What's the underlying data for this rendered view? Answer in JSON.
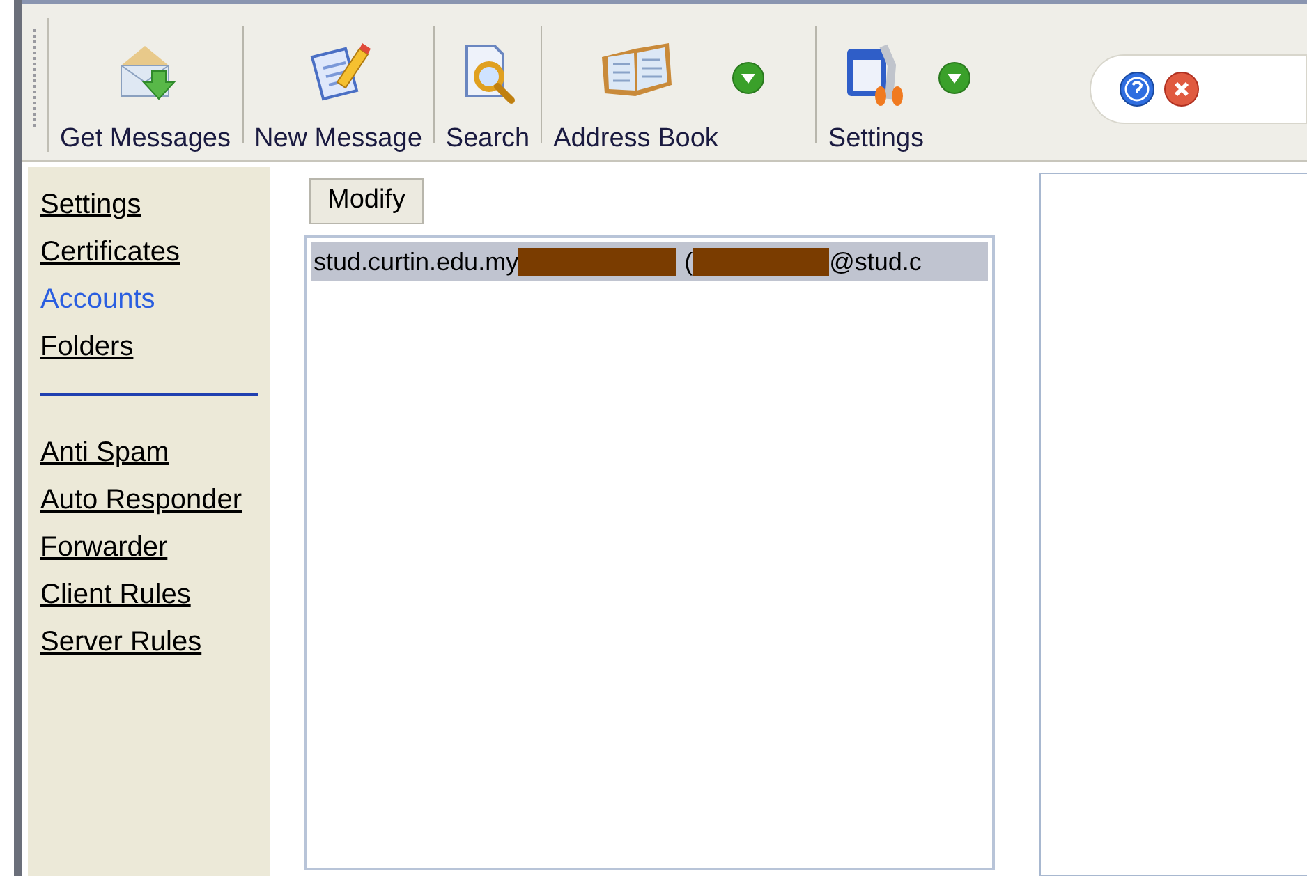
{
  "toolbar": {
    "buttons": [
      {
        "label": "Get Messages",
        "kind": "get",
        "dropdown": false
      },
      {
        "label": "New Message",
        "kind": "new",
        "dropdown": false
      },
      {
        "label": "Search",
        "kind": "search",
        "dropdown": false
      },
      {
        "label": "Address Book",
        "kind": "book",
        "dropdown": true
      },
      {
        "label": "Settings",
        "kind": "settings",
        "dropdown": true
      }
    ]
  },
  "sidebar": {
    "groups": [
      [
        {
          "label": "Settings",
          "selected": false
        },
        {
          "label": "Certificates",
          "selected": false
        },
        {
          "label": "Accounts",
          "selected": true
        },
        {
          "label": "Folders",
          "selected": false
        }
      ],
      [
        {
          "label": "Anti Spam",
          "selected": false
        },
        {
          "label": "Auto Responder",
          "selected": false
        },
        {
          "label": "Forwarder",
          "selected": false
        },
        {
          "label": "Client Rules",
          "selected": false
        },
        {
          "label": "Server Rules",
          "selected": false
        }
      ]
    ]
  },
  "modify_button": "Modify",
  "accounts": [
    {
      "prefix": "stud.curtin.edu.my",
      "middle": "(",
      "suffix": "@stud.c",
      "selected": true
    }
  ]
}
